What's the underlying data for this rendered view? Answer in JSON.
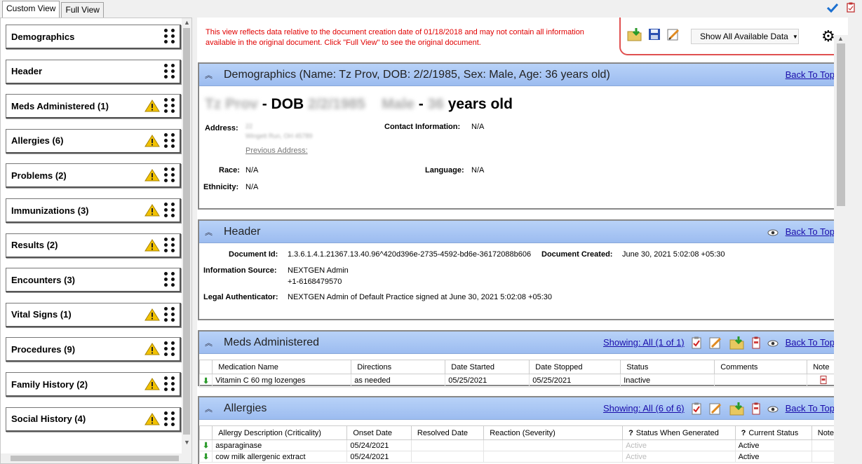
{
  "tabs": [
    {
      "label": "Custom View"
    },
    {
      "label": "Full View"
    }
  ],
  "sidebar": {
    "items": [
      {
        "label": "Demographics",
        "warn": false
      },
      {
        "label": "Header",
        "warn": false
      },
      {
        "label": "Meds Administered (1)",
        "warn": true
      },
      {
        "label": "Allergies (6)",
        "warn": true
      },
      {
        "label": "Problems (2)",
        "warn": true
      },
      {
        "label": "Immunizations (3)",
        "warn": true
      },
      {
        "label": "Results (2)",
        "warn": true
      },
      {
        "label": "Encounters (3)",
        "warn": false
      },
      {
        "label": "Vital Signs (1)",
        "warn": true
      },
      {
        "label": "Procedures (9)",
        "warn": true
      },
      {
        "label": "Family History (2)",
        "warn": true
      },
      {
        "label": "Social History (4)",
        "warn": true
      }
    ]
  },
  "notice": "This view reflects data relative to the document creation date of 01/18/2018 and may not contain all information available in the original document. Click \"Full View\" to see the original document.",
  "toolbar": {
    "filter_label": "Show All Available Data"
  },
  "back_to_top": "Back To Top",
  "demographics": {
    "title": "Demographics (Name: Tz Prov, DOB: 2/2/1985, Sex: Male, Age: 36 years old)",
    "banner_name": "Tz Prov",
    "banner_dob_label": "DOB",
    "banner_dob": "2/2/1985",
    "banner_sex": "Male",
    "banner_age": "36",
    "banner_age_suffix": "years old",
    "address_label": "Address:",
    "address_line1": "22",
    "address_line2": "Wingett Run, OH 45789",
    "previous_address": "Previous Address:",
    "contact_label": "Contact Information:",
    "contact_value": "N/A",
    "race_label": "Race:",
    "race_value": "N/A",
    "language_label": "Language:",
    "language_value": "N/A",
    "ethnicity_label": "Ethnicity:",
    "ethnicity_value": "N/A"
  },
  "header": {
    "title": "Header",
    "doc_id_label": "Document Id:",
    "doc_id": "1.3.6.1.4.1.21367.13.40.96^420d396e-2735-4592-bd6e-36172088b606",
    "doc_created_label": "Document Created:",
    "doc_created": "June 30, 2021 5:02:08 +05:30",
    "info_source_label": "Information Source:",
    "info_source_name": "NEXTGEN Admin",
    "info_source_phone": "+1-6168479570",
    "legal_label": "Legal Authenticator:",
    "legal_value": "NEXTGEN Admin of Default Practice signed at June 30, 2021 5:02:08 +05:30"
  },
  "meds": {
    "title": "Meds Administered",
    "showing": "Showing: All (1 of 1)",
    "columns": [
      "Medication Name",
      "Directions",
      "Date Started",
      "Date Stopped",
      "Status",
      "Comments",
      "Note"
    ],
    "rows": [
      {
        "name": "Vitamin C 60 mg lozenges",
        "directions": "as needed",
        "started": "05/25/2021",
        "stopped": "05/25/2021",
        "status": "Inactive",
        "comments": ""
      }
    ]
  },
  "allergies": {
    "title": "Allergies",
    "showing": "Showing: All (6 of 6)",
    "columns": [
      "Allergy Description (Criticality)",
      "Onset Date",
      "Resolved Date",
      "Reaction (Severity)",
      "Status When Generated",
      "Current Status",
      "Note"
    ],
    "rows": [
      {
        "desc": "asparaginase",
        "onset": "05/24/2021",
        "resolved": "",
        "reaction": "",
        "gen_status": "Active",
        "cur_status": "Active"
      },
      {
        "desc": "cow milk allergenic extract",
        "onset": "05/24/2021",
        "resolved": "",
        "reaction": "",
        "gen_status": "Active",
        "cur_status": "Active"
      }
    ]
  }
}
